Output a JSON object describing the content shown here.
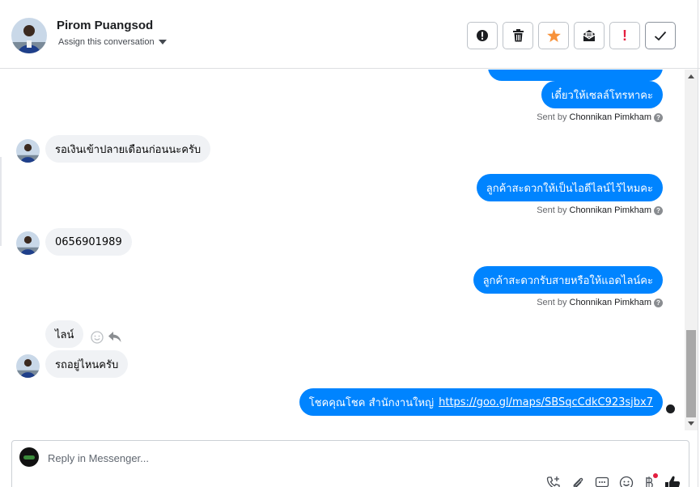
{
  "header": {
    "contact_name": "Pirom Puangsod",
    "assign_label": "Assign this conversation",
    "actions": [
      {
        "name": "mark-spam-button",
        "icon": "alert-circle-icon"
      },
      {
        "name": "delete-button",
        "icon": "trash-icon"
      },
      {
        "name": "star-button",
        "icon": "star-icon",
        "color": "#f7923b"
      },
      {
        "name": "archive-button",
        "icon": "mail-open-icon"
      },
      {
        "name": "mark-important-button",
        "icon": "exclamation-icon",
        "color": "#e41e3f",
        "label": "!"
      },
      {
        "name": "mark-done-button",
        "icon": "check-icon"
      }
    ]
  },
  "thread": {
    "sent_by_prefix": "Sent by",
    "messages": [
      {
        "direction": "out",
        "text": "เดี๋ยวให้เซลล์โทรหาคะ",
        "sender": "Chonnikan Pimkham"
      },
      {
        "direction": "in",
        "text": "รอเงินเข้าปลายเดือนก่อนนะครับ"
      },
      {
        "direction": "out",
        "text": "ลูกค้าสะดวกให้เป็นไอดีไลน์ไว้ไหมคะ",
        "sender": "Chonnikan Pimkham"
      },
      {
        "direction": "in",
        "text": "0656901989"
      },
      {
        "direction": "out",
        "text": "ลูกค้าสะดวกรับสายหรือให้แอดไลน์คะ",
        "sender": "Chonnikan Pimkham"
      },
      {
        "direction": "in",
        "text": "ไลน์"
      },
      {
        "direction": "in",
        "text": "รถอยู่ไหนครับ"
      },
      {
        "direction": "out",
        "text": "โชคคุณโชค สำนักงานใหญ่",
        "link": "https://goo.gl/maps/SBSqcCdkC923sjbx7"
      }
    ]
  },
  "composer": {
    "placeholder": "Reply in Messenger...",
    "value": "",
    "tools": [
      "call-add-icon",
      "attachment-icon",
      "saved-reply-icon",
      "emoji-icon",
      "payment-icon",
      "like-icon"
    ]
  },
  "colors": {
    "accent": "#0084ff",
    "incoming_bubble": "#f0f2f5",
    "star": "#f7923b",
    "alert": "#e41e3f"
  }
}
